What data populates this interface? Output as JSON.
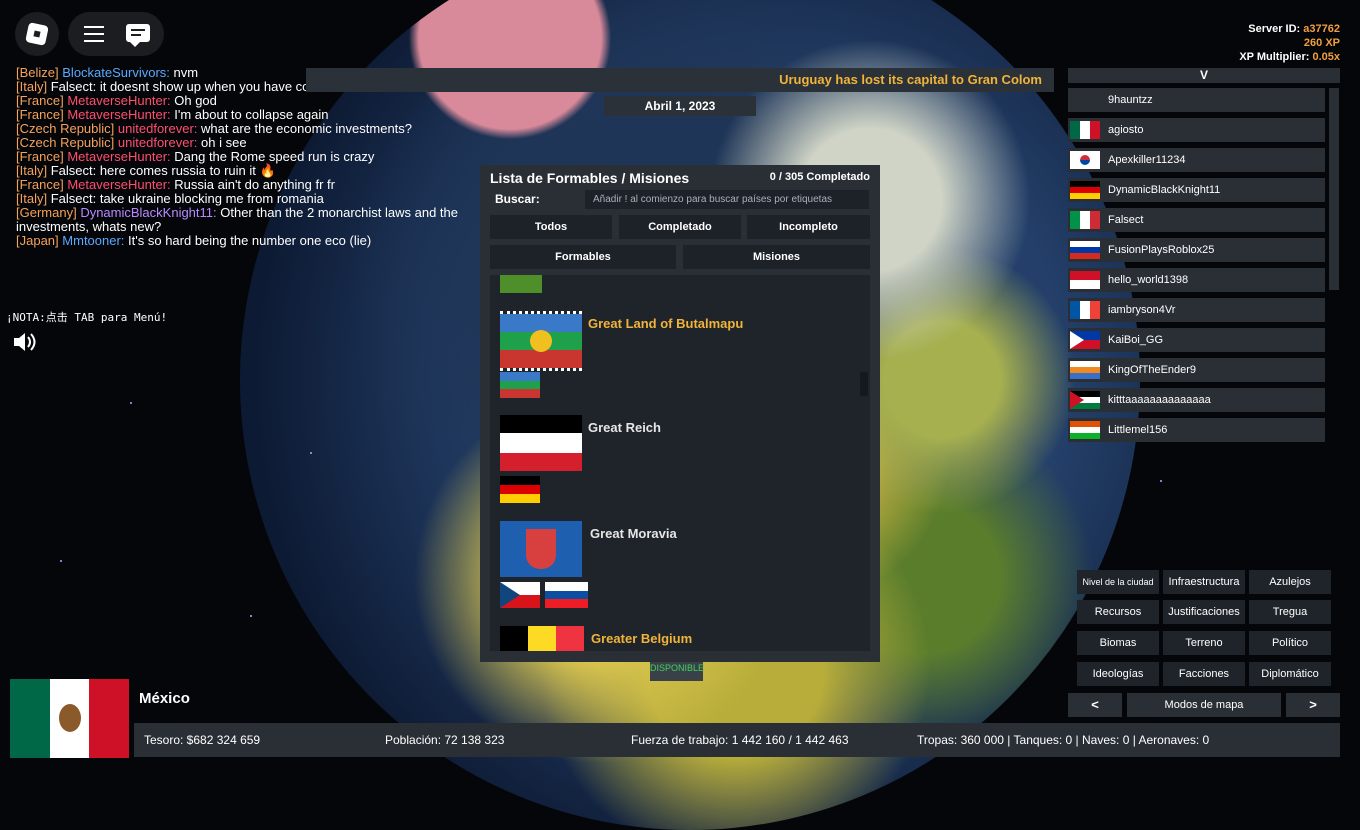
{
  "server": {
    "id_label": "Server ID:",
    "id_value": "a37762",
    "xp": "260 XP",
    "mult_label": "XP Multiplier:",
    "mult_value": "0.05x"
  },
  "chat": [
    {
      "country": "[Belize]",
      "user": "BlockateSurvivors:",
      "user_color": "blue",
      "text": " nvm"
    },
    {
      "country": "[Italy]",
      "user": "Falsect:",
      "user_color": "white",
      "text": " it doesnt show up when you have communism"
    },
    {
      "country": "[France]",
      "user": "MetaverseHunter:",
      "user_color": "red",
      "text": " Oh god"
    },
    {
      "country": "[France]",
      "user": "MetaverseHunter:",
      "user_color": "red",
      "text": " I'm about to collapse again"
    },
    {
      "country": "[Czech Republic]",
      "user": "unitedforever:",
      "user_color": "red",
      "text": " what are the economic investments?"
    },
    {
      "country": "[Czech Republic]",
      "user": "unitedforever:",
      "user_color": "red",
      "text": " oh i see"
    },
    {
      "country": "[France]",
      "user": "MetaverseHunter:",
      "user_color": "red",
      "text": " Dang the Rome speed run is crazy"
    },
    {
      "country": "[Italy]",
      "user": "Falsect:",
      "user_color": "white",
      "text": " here comes russia to ruin it 🔥"
    },
    {
      "country": "[France]",
      "user": "MetaverseHunter:",
      "user_color": "red",
      "text": " Russia ain't do anything fr fr"
    },
    {
      "country": "[Italy]",
      "user": "Falsect:",
      "user_color": "white",
      "text": " take ukraine blocking me from romania"
    },
    {
      "country": "[Germany]",
      "user": "DynamicBlackKnight11:",
      "user_color": "purple",
      "text": " Other than the 2 monarchist laws and the investments, whats new?"
    },
    {
      "country": "[Japan]",
      "user": "Mmtooner:",
      "user_color": "blue",
      "text": " It's so hard being the number one eco (lie)"
    }
  ],
  "nota": "¡NOTA:点击 TAB para Menú!",
  "banner": "Uruguay has lost its capital to Gran Colom",
  "date": "Abril 1, 2023",
  "panel": {
    "title": "Lista de Formables / Misiones",
    "count": "0 / 305 Completado",
    "search_label": "Buscar:",
    "search_placeholder": "Añadir ! al comienzo para buscar países por etiquetas",
    "tabs": [
      "Todos",
      "Completado",
      "Incompleto"
    ],
    "tabs2": [
      "Formables",
      "Misiones"
    ],
    "items": [
      {
        "name": "Great Land of Butalmapu",
        "color": "#f0b43a"
      },
      {
        "name": "Great Reich",
        "color": "#e6e6e6"
      },
      {
        "name": "Great Moravia",
        "color": "#e6e6e6"
      },
      {
        "name": "Greater Belgium",
        "color": "#f0b43a"
      }
    ],
    "disponible": "DISPONIBLE"
  },
  "players": {
    "header": "V",
    "list": [
      "9hauntzz",
      "agiosto",
      "Apexkiller11234",
      "DynamicBlackKnight11",
      "Falsect",
      "FusionPlaysRoblox25",
      "hello_world1398",
      "iambryson4Vr",
      "KaiBoi_GG",
      "KingOfTheEnder9",
      "kitttaaaaaaaaaaaaaa",
      "Littlemel156"
    ]
  },
  "map_modes": {
    "buttons": [
      "Nivel de la ciudad",
      "Infraestructura",
      "Azulejos",
      "Recursos",
      "Justificaciones",
      "Tregua",
      "Biomas",
      "Terreno",
      "Político",
      "Ideologías",
      "Facciones",
      "Diplomático"
    ],
    "prev": "<",
    "label": "Modos de mapa",
    "next": ">"
  },
  "country": "México",
  "stats": {
    "tesoro": "Tesoro: $682 324 659",
    "poblacion": "Población: 72 138 323",
    "fuerza": "Fuerza de trabajo: 1 442 160 / 1 442 463",
    "tropas": "Tropas: 360 000 | Tanques: 0 | Naves: 0 | Aeronaves: 0"
  }
}
